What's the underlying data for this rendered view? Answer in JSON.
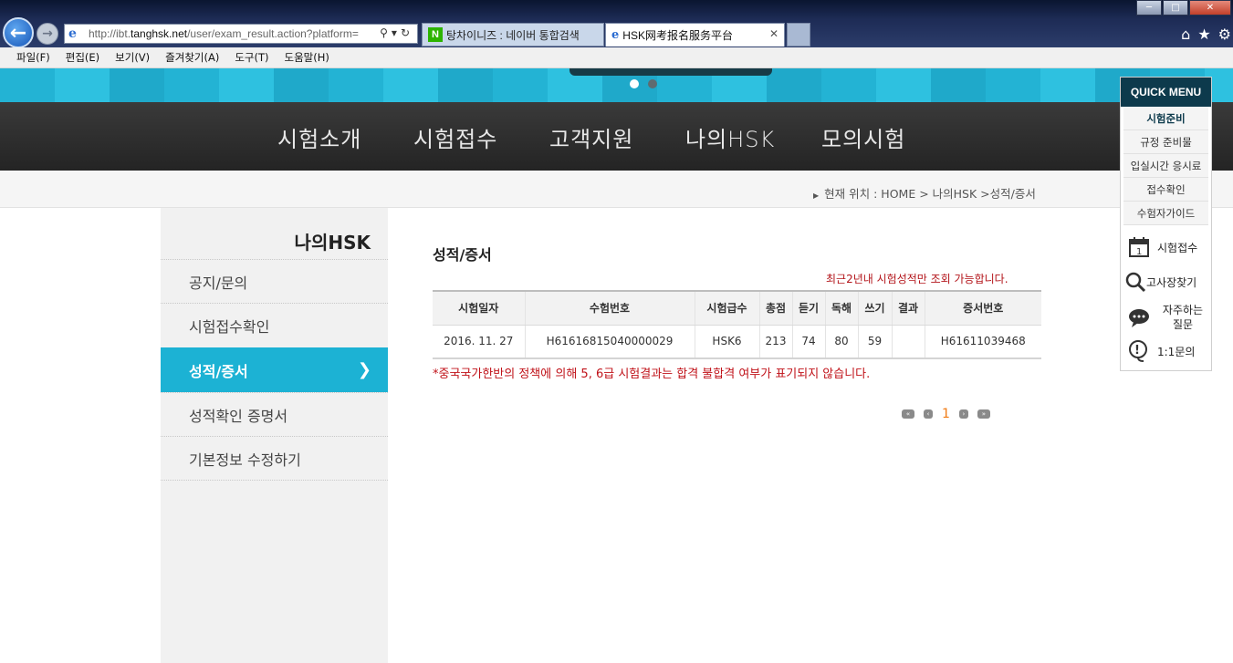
{
  "browser": {
    "address_prefix": "http://ibt.",
    "address_domain": "tanghsk.net",
    "address_rest": "/user/exam_result.action?platform=",
    "tabs": [
      {
        "label": "탕차이니즈 : 네이버 통합검색"
      },
      {
        "label": "HSK网考报名服务平台"
      }
    ],
    "menu": [
      "파일(F)",
      "편집(E)",
      "보기(V)",
      "즐겨찾기(A)",
      "도구(T)",
      "도움말(H)"
    ]
  },
  "nav": {
    "items": [
      "시험소개",
      "시험접수",
      "고객지원",
      "나의HSK",
      "모의시험"
    ]
  },
  "location": {
    "label": "현재 위치",
    "path": ": HOME > 나의HSK >성적/증서"
  },
  "sidebar": {
    "title": "나의HSK",
    "items": [
      {
        "label": "공지/문의"
      },
      {
        "label": "시험접수확인"
      },
      {
        "label": "성적/증서"
      },
      {
        "label": "성적확인 증명서"
      },
      {
        "label": "기본정보 수정하기"
      }
    ]
  },
  "content": {
    "title": "성적/증서",
    "notice": "최근2년내 시험성적만 조회 가능합니다.",
    "table": {
      "headers": [
        "시험일자",
        "수험번호",
        "시험급수",
        "총점",
        "듣기",
        "독해",
        "쓰기",
        "결과",
        "증서번호"
      ],
      "rows": [
        [
          "2016. 11. 27",
          "H61616815040000029",
          "HSK6",
          "213",
          "74",
          "80",
          "59",
          "",
          "H61611039468"
        ]
      ]
    },
    "footnote": "*중국국가한반의 정책에 의해 5, 6급 시험결과는 합격 불합격 여부가 표기되지 않습니다.",
    "pagination": {
      "current": "1"
    }
  },
  "quick_menu": {
    "title": "QUICK MENU",
    "links": [
      "시험준비",
      "규정 준비물",
      "입실시간 응시료",
      "접수확인",
      "수험자가이드"
    ],
    "icons": [
      {
        "label": "시험접수",
        "icon": "calendar-icon"
      },
      {
        "label": "고사장찾기",
        "icon": "magnifier-icon"
      },
      {
        "label": "자주하는 질문",
        "icon": "speech-bubble-icon"
      },
      {
        "label": "1:1문의",
        "icon": "question-headset-icon"
      }
    ]
  },
  "colors": {
    "accent": "#1cb2d4",
    "nav_bg": "#2e2e2e",
    "quick_head": "#0d3a4c",
    "warning": "#b3141a",
    "page_active": "#f07b14"
  }
}
